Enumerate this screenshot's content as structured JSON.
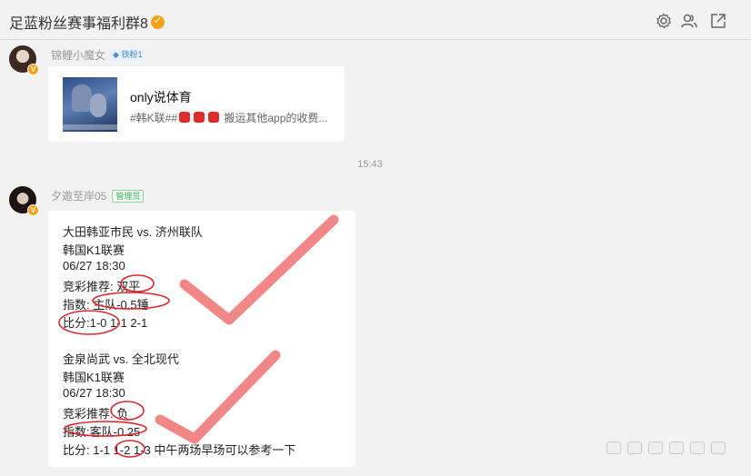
{
  "header": {
    "title": "足蓝粉丝赛事福利群8",
    "icons": [
      "gear-icon",
      "group-members-icon",
      "open-external-icon"
    ]
  },
  "messages": [
    {
      "sender": "锦鲤小魔女",
      "fan_badge": "铁粉1",
      "card": {
        "title": "only说体育",
        "desc_prefix": "#韩K联##",
        "desc_suffix": "搬运其他app的收费..."
      }
    },
    {
      "time": "15:43",
      "sender": "夕邀至岸05",
      "role_badge": "管理员",
      "lines": [
        "大田韩亚市民 vs. 济州联队",
        "韩国K1联赛",
        "06/27 18:30",
        "竞彩推荐: 双平",
        "指数: 主队-0.5锤",
        "比分:1-0   1-1   2-1",
        "",
        "金泉尚武 vs. 全北现代",
        "韩国K1联赛",
        "06/27 18:30",
        "竞彩推荐: 负",
        "指数:客队-0.25",
        "比分: 1-1   1-2    1-3      中午两场早场可以参考一下"
      ]
    }
  ],
  "colors": {
    "background": "#f2f2f2",
    "card": "#ffffff",
    "accent_badge": "#f7a21b",
    "annotation_red": "#d9272e",
    "checkmark": "#f07a7a"
  }
}
